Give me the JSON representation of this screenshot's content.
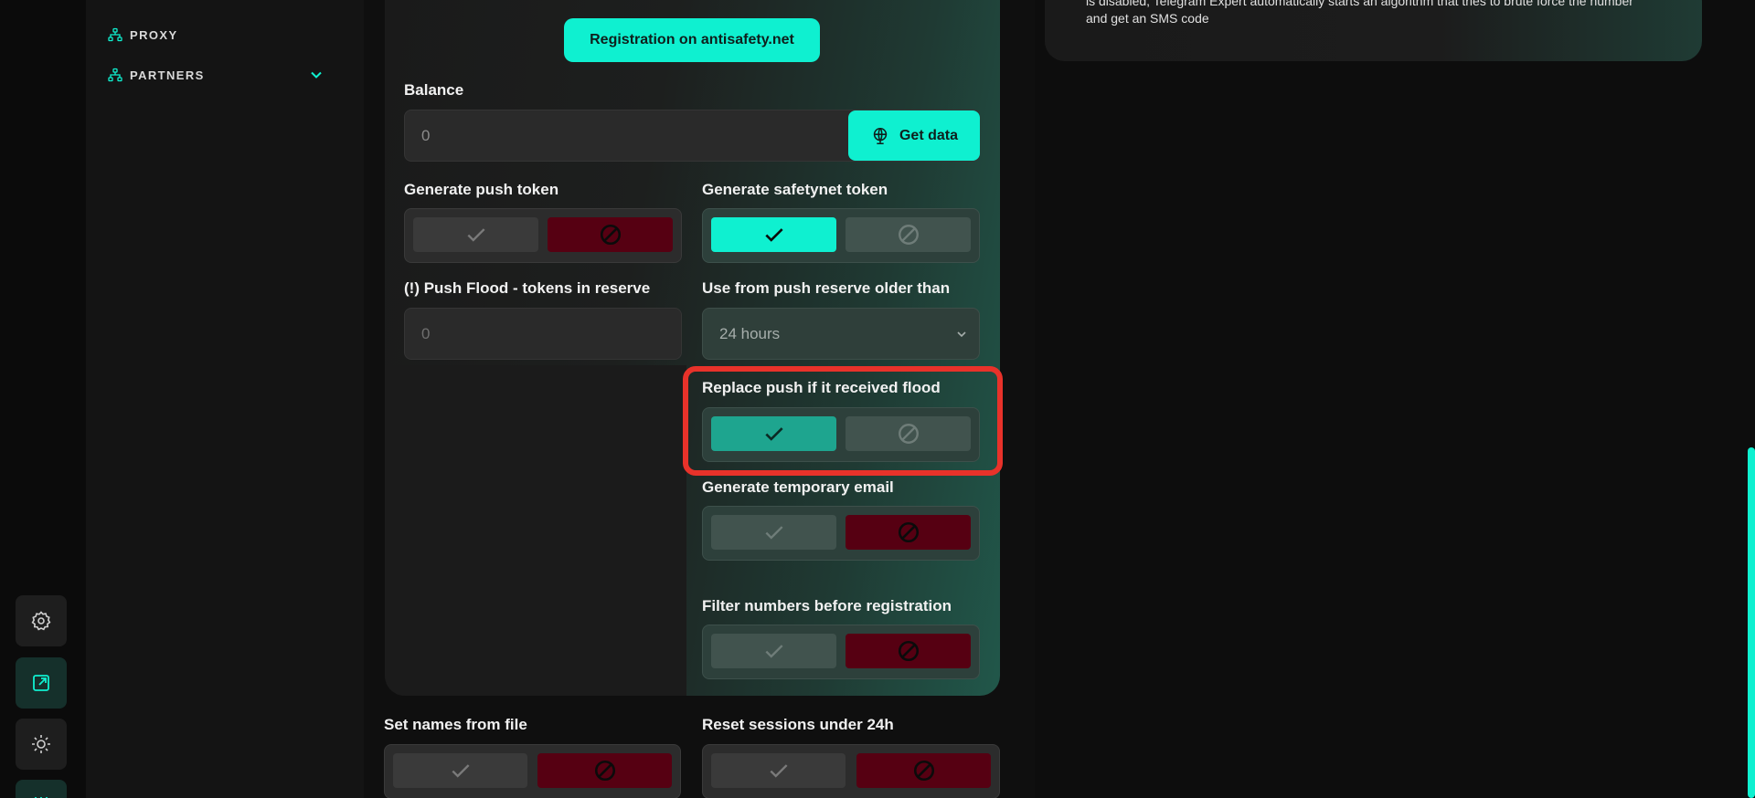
{
  "sidebar": {
    "items": [
      {
        "label": "PROXY",
        "icon": "network-icon"
      },
      {
        "label": "PARTNERS",
        "icon": "network-icon"
      }
    ]
  },
  "rail": {
    "buttons": [
      "settings-icon",
      "external-link-icon",
      "brightness-icon",
      "sliders-icon"
    ]
  },
  "form": {
    "registration_button": "Registration on antisafety.net",
    "balance_label": "Balance",
    "balance_value": "0",
    "get_data_button": "Get data",
    "generate_push_token_label": "Generate push token",
    "generate_safetynet_token_label": "Generate safetynet token",
    "push_flood_label": "(!) Push Flood - tokens in reserve",
    "push_flood_placeholder": "0",
    "use_reserve_label": "Use from push reserve older than",
    "use_reserve_value": "24 hours",
    "replace_push_label": "Replace push if it received flood",
    "generate_temp_email_label": "Generate temporary email",
    "filter_numbers_label": "Filter numbers before registration",
    "set_names_label": "Set names from file",
    "reset_sessions_label": "Reset sessions under 24h"
  },
  "toggles": {
    "generate_push_token": "off",
    "generate_safetynet_token": "on",
    "replace_push": "on",
    "generate_temp_email": "off",
    "filter_numbers": "off",
    "set_names": "off",
    "reset_sessions": "off"
  },
  "info": {
    "text_line1": "is disabled, Telegram Expert automatically starts an algorithm that tries to brute force the number",
    "text_line2": "and get an SMS code"
  },
  "colors": {
    "accent": "#0ff0d0",
    "danger": "#560012",
    "highlight": "#e8322a"
  }
}
